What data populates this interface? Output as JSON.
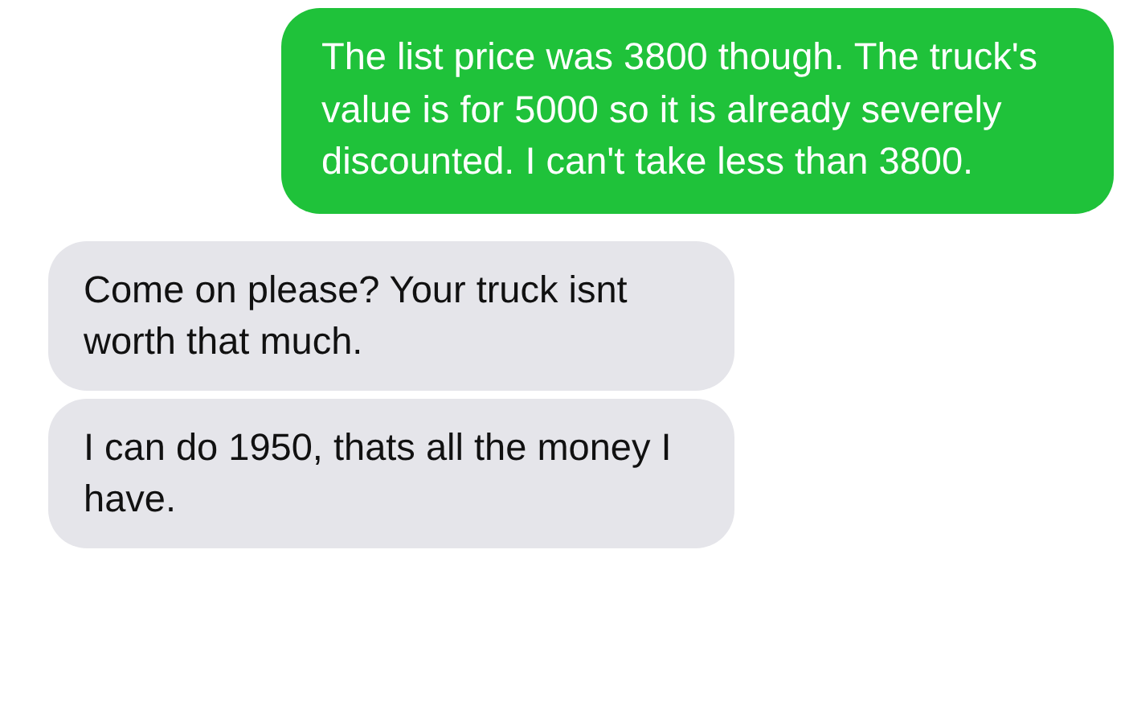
{
  "messages": [
    {
      "kind": "sent",
      "text": "The list price was 3800 though. The truck's value is for 5000 so it is already severely discounted. I can't take less than 3800."
    },
    {
      "kind": "received",
      "text": "Come on please? Your truck isnt worth that much."
    },
    {
      "kind": "received",
      "text": "I can do 1950, thats all the money I have."
    }
  ]
}
